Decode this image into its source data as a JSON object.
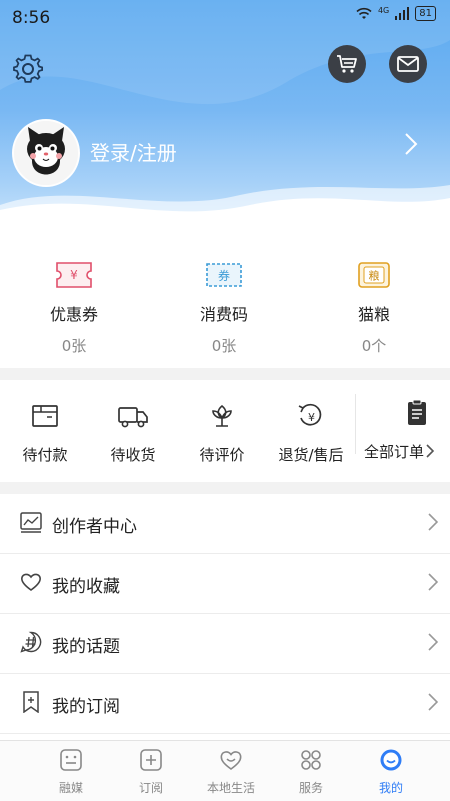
{
  "status_bar": {
    "time": "8:56",
    "network": "4G",
    "battery": "81"
  },
  "header": {
    "login_text": "登录/注册"
  },
  "wallet": [
    {
      "label": "优惠券",
      "count": "0张",
      "icon": "coupon-icon",
      "icon_text": "¥",
      "color": "#e04e6a"
    },
    {
      "label": "消费码",
      "count": "0张",
      "icon": "voucher-code-icon",
      "icon_text": "券",
      "color": "#3a9bd6"
    },
    {
      "label": "猫粮",
      "count": "0个",
      "icon": "cat-food-icon",
      "icon_text": "粮",
      "color": "#e0a020"
    }
  ],
  "orders": {
    "items": [
      {
        "label": "待付款",
        "icon": "wallet-icon"
      },
      {
        "label": "待收货",
        "icon": "truck-icon"
      },
      {
        "label": "待评价",
        "icon": "flower-icon"
      },
      {
        "label": "退货/售后",
        "icon": "refund-icon"
      }
    ],
    "all_label": "全部订单"
  },
  "menu": [
    {
      "label": "创作者中心",
      "icon": "chart-icon"
    },
    {
      "label": "我的收藏",
      "icon": "heart-icon"
    },
    {
      "label": "我的话题",
      "icon": "hashtag-icon"
    },
    {
      "label": "我的订阅",
      "icon": "bookmark-plus-icon"
    }
  ],
  "tabs": [
    {
      "label": "融媒",
      "icon": "media-icon",
      "active": false
    },
    {
      "label": "订阅",
      "icon": "subscribe-icon",
      "active": false
    },
    {
      "label": "本地生活",
      "icon": "local-life-icon",
      "active": false
    },
    {
      "label": "服务",
      "icon": "services-icon",
      "active": false
    },
    {
      "label": "我的",
      "icon": "profile-icon",
      "active": true
    }
  ],
  "colors": {
    "accent": "#2f7df6",
    "header_blue": "#5aa9f0"
  }
}
